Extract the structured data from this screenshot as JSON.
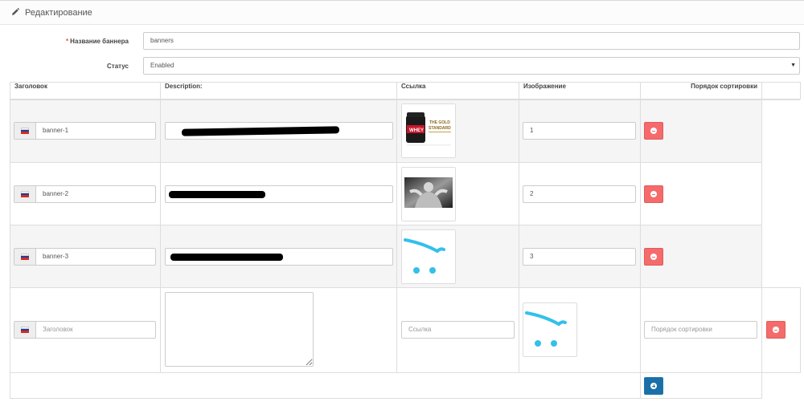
{
  "header": {
    "title": "Редактирование",
    "icon": "pencil-icon"
  },
  "form": {
    "name_label": "Название баннера",
    "name_value": "banners",
    "status_label": "Статус",
    "status_value": "Enabled"
  },
  "table": {
    "columns": [
      "Заголовок",
      "Description:",
      "Ссылка",
      "Изображение",
      "Порядок сортировки"
    ],
    "rows": [
      {
        "title": "banner-1",
        "description_redacted": true,
        "image": "whey-product",
        "sort": "1"
      },
      {
        "title": "banner-2",
        "description_redacted": true,
        "image": "bodybuilder-photo",
        "sort": "2"
      },
      {
        "title": "banner-3",
        "description_redacted": true,
        "image": "cart-placeholder",
        "sort": "3"
      }
    ],
    "new_row": {
      "title_placeholder": "Заголовок",
      "link_placeholder": "Ссылка",
      "image": "cart-placeholder",
      "sort_placeholder": "Порядок сортировки"
    }
  },
  "colors": {
    "danger": "#f56b6b",
    "primary": "#1b6fa8",
    "flag_white": "#ffffff",
    "flag_blue": "#1c3fa0",
    "flag_red": "#d52b1e"
  },
  "icons": {
    "remove": "minus-circle-icon",
    "add": "plus-circle-icon",
    "flag": "russia-flag-icon"
  }
}
